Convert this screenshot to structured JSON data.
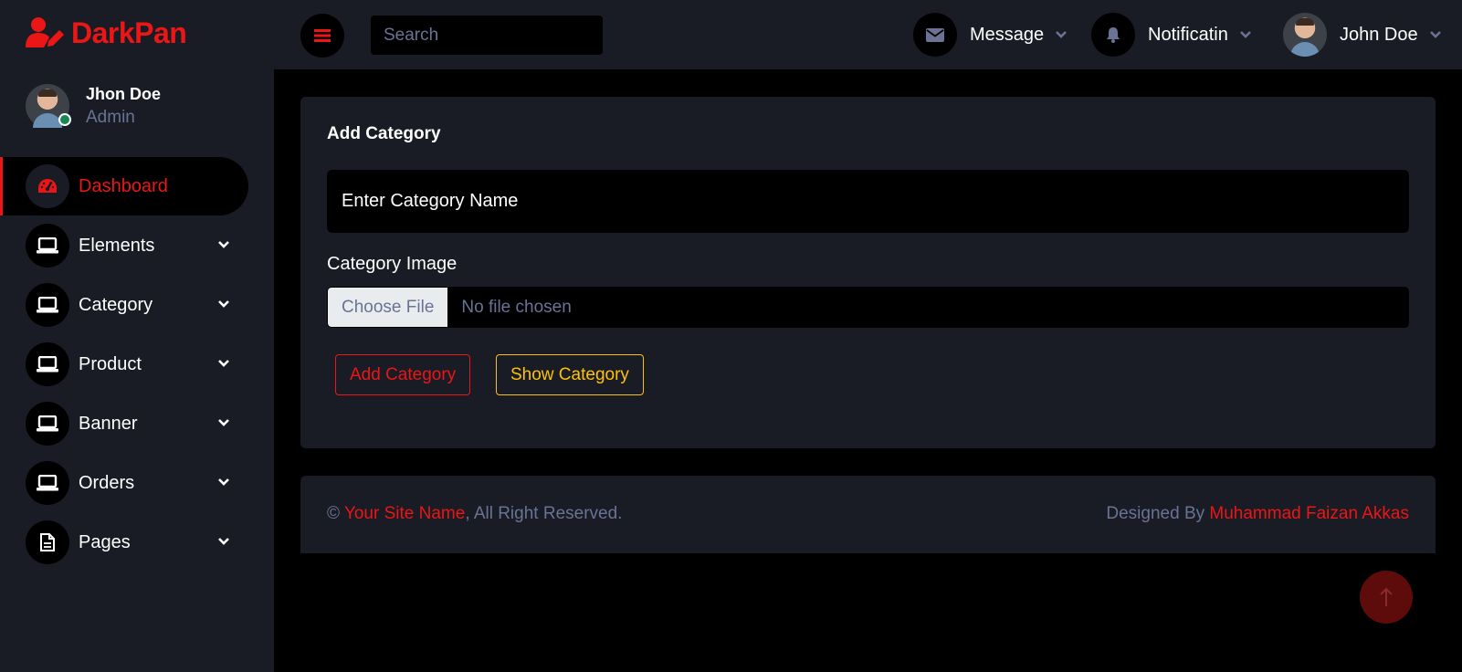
{
  "brand": {
    "name": "DarkPan",
    "color": "#eb1616",
    "icon": "user-edit-icon"
  },
  "profile": {
    "name": "Jhon Doe",
    "role": "Admin",
    "status_color": "#198754"
  },
  "nav": {
    "items": [
      {
        "label": "Dashboard",
        "icon": "tachometer-icon",
        "active": true
      },
      {
        "label": "Elements",
        "icon": "laptop-icon"
      },
      {
        "label": "Category",
        "icon": "laptop-icon"
      },
      {
        "label": "Product",
        "icon": "laptop-icon"
      },
      {
        "label": "Banner",
        "icon": "laptop-icon"
      },
      {
        "label": "Orders",
        "icon": "laptop-icon"
      },
      {
        "label": "Pages",
        "icon": "file-icon"
      }
    ]
  },
  "topbar": {
    "search_placeholder": "Search",
    "message_label": "Message",
    "notification_label": "Notificatin",
    "user_label": "John Doe"
  },
  "form": {
    "title": "Add Category",
    "name_placeholder": "Enter Category Name",
    "image_label": "Category Image",
    "file_button": "Choose File",
    "file_status": "No file chosen",
    "add_button": "Add Category",
    "show_button": "Show Category"
  },
  "footer": {
    "copyright_symbol": "©",
    "site_name": "Your Site Name",
    "rights": ", All Right Reserved.",
    "designed_by": "Designed By",
    "designer": "Muhammad Faizan Akkas"
  },
  "colors": {
    "bg": "#000000",
    "panel": "#191c24",
    "accent": "#eb1616",
    "warning": "#ffc107",
    "muted": "#6c7293"
  }
}
